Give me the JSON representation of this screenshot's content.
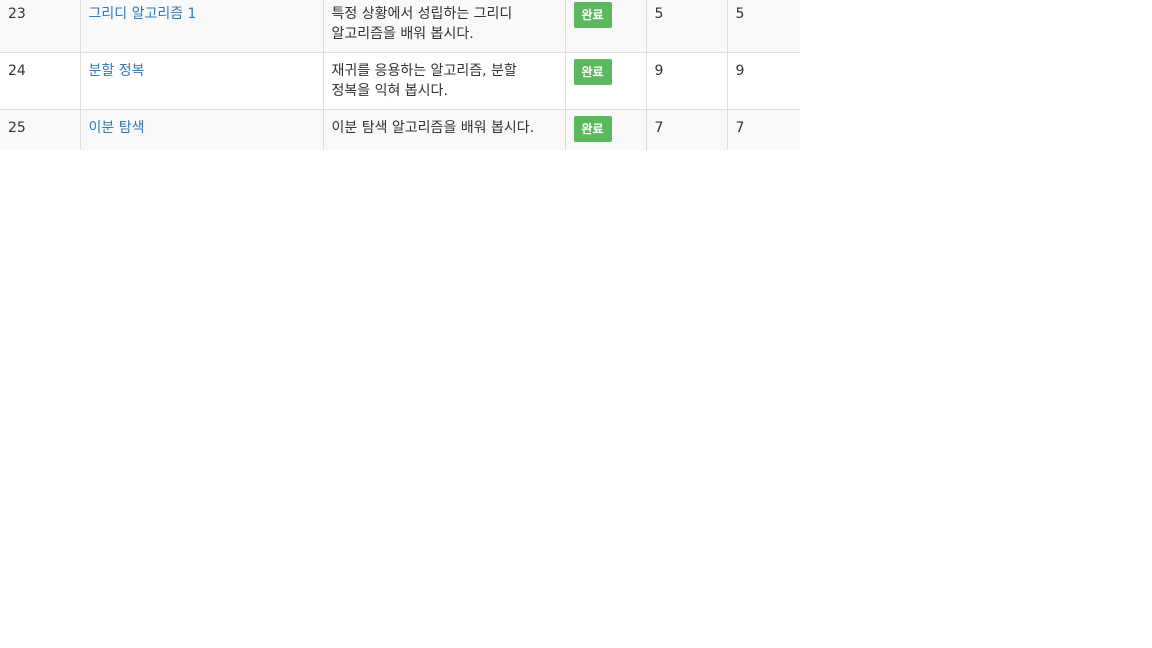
{
  "table": {
    "rows": [
      {
        "id": "23",
        "title": "그리디 알고리즘 1",
        "description": "특정 상황에서 성립하는 그리디 알고리즘을 배워 봅시다.",
        "status": "완료",
        "solved": "5",
        "total": "5"
      },
      {
        "id": "24",
        "title": "분할 정복",
        "description": "재귀를 응용하는 알고리즘, 분할 정복을 익혀 봅시다.",
        "status": "완료",
        "solved": "9",
        "total": "9"
      },
      {
        "id": "25",
        "title": "이분 탐색",
        "description": "이분 탐색 알고리즘을 배워 봅시다.",
        "status": "완료",
        "solved": "7",
        "total": "7"
      }
    ]
  },
  "colors": {
    "link": "#337ab7",
    "status_complete": "#5cb85c",
    "row_stripe": "#f9f9f9",
    "border": "#dddddd"
  }
}
